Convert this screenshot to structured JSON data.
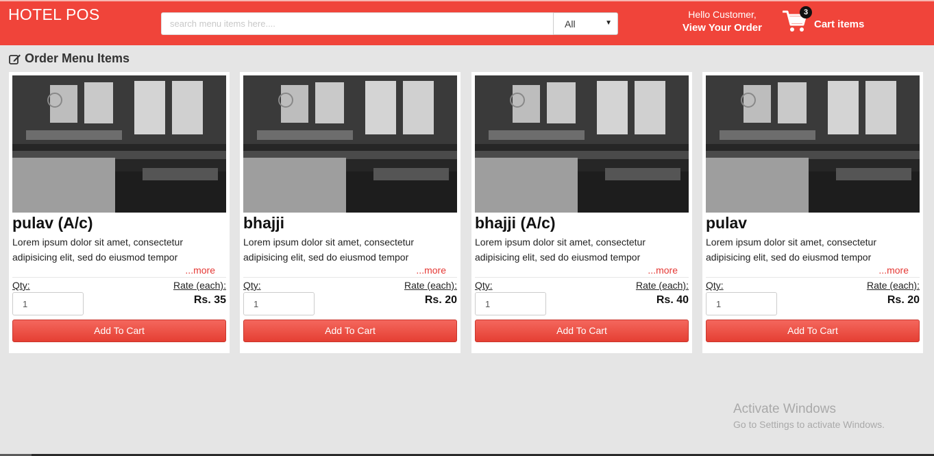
{
  "header": {
    "brand": "HOTEL POS",
    "search_placeholder": "search menu items here....",
    "category_selected": "All",
    "greeting": "Hello Customer,",
    "view_order": "View Your Order",
    "cart_count": "3",
    "cart_label": "Cart items",
    "bg_color": "#f0443a"
  },
  "section": {
    "title": "Order Menu Items"
  },
  "menu_items": [
    {
      "name": "pulav (A/c)",
      "description": "Lorem ipsum dolor sit amet, consectetur adipisicing elit, sed do eiusmod tempor",
      "more": "...more",
      "qty_label": "Qty:",
      "qty_value": "1",
      "rate_label": "Rate (each):",
      "price": "Rs. 35",
      "button": "Add To Cart"
    },
    {
      "name": "bhajji",
      "description": "Lorem ipsum dolor sit amet, consectetur adipisicing elit, sed do eiusmod tempor",
      "more": "...more",
      "qty_label": "Qty:",
      "qty_value": "1",
      "rate_label": "Rate (each):",
      "price": "Rs. 20",
      "button": "Add To Cart"
    },
    {
      "name": "bhajji (A/c)",
      "description": "Lorem ipsum dolor sit amet, consectetur adipisicing elit, sed do eiusmod tempor",
      "more": "...more",
      "qty_label": "Qty:",
      "qty_value": "1",
      "rate_label": "Rate (each):",
      "price": "Rs. 40",
      "button": "Add To Cart"
    },
    {
      "name": "pulav",
      "description": "Lorem ipsum dolor sit amet, consectetur adipisicing elit, sed do eiusmod tempor",
      "more": "...more",
      "qty_label": "Qty:",
      "qty_value": "1",
      "rate_label": "Rate (each):",
      "price": "Rs. 20",
      "button": "Add To Cart"
    }
  ],
  "watermark": {
    "line1": "Activate Windows",
    "line2": "Go to Settings to activate Windows."
  }
}
